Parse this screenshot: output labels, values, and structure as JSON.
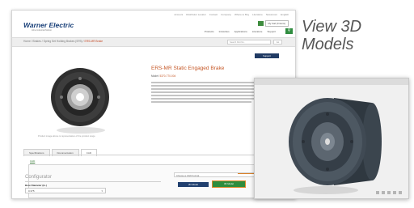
{
  "utility_links": [
    "Account",
    "Distributor Locator",
    "Contact",
    "Company",
    "Where to Buy",
    "Literature",
    "Newsroom",
    "English"
  ],
  "brand": {
    "name": "Warner Electric",
    "tagline": "Altra Industrial Motion"
  },
  "cart_label": "My Cart (0 items)",
  "main_nav": [
    "Products",
    "Industries",
    "Applications",
    "Literature",
    "Support"
  ],
  "breadcrumb": {
    "items": [
      "Home",
      "Brakes",
      "Spring Set Holding Brakes (SFB)"
    ],
    "current": "ERS-MR Brake"
  },
  "product_search_placeholder": "Search Part No.",
  "product_search_go": "Go",
  "support_button": "Support",
  "image_caption": "Product image above is representative of the product range",
  "product": {
    "title": "ERS-MR Static Engaged Brake",
    "model_label": "Model:",
    "model_value": "5370-770-004"
  },
  "tabs": [
    "Specifications",
    "Documentation",
    "CAD"
  ],
  "active_tab": "CAD",
  "sub_label": "CAD",
  "configurator": {
    "title": "Configurator",
    "bore_label": "Bore Diameter (in.)",
    "bore_value": "0.375",
    "cad_format_label": "Choose a CAD Format",
    "button_2d": "2D Model",
    "button_3d": "3D Model"
  },
  "callout": {
    "line1": "View 3D",
    "line2": "Models"
  },
  "colors": {
    "accent_orange": "#c55726",
    "brand_blue": "#183f78",
    "green": "#2e8d3d"
  }
}
